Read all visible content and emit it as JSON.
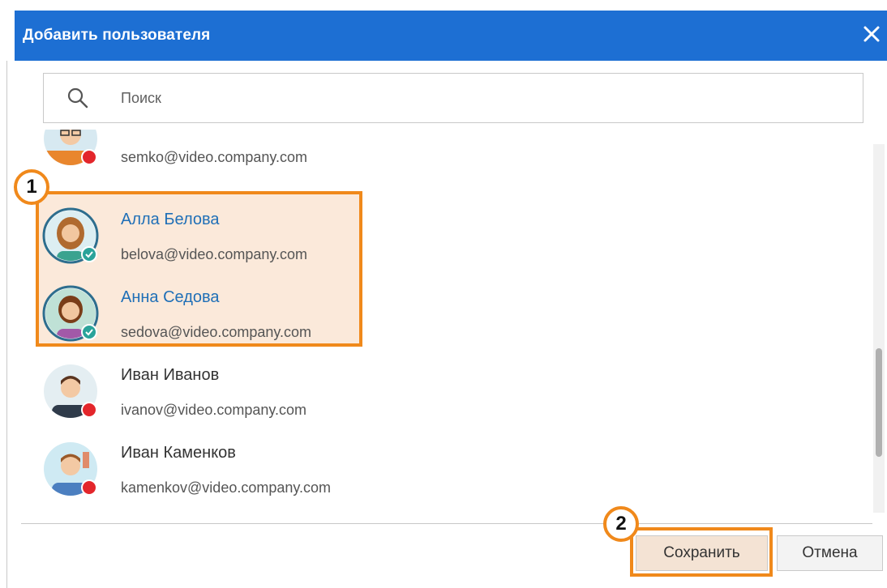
{
  "dialog": {
    "title": "Добавить пользователя"
  },
  "search": {
    "placeholder": "Поиск"
  },
  "users": [
    {
      "name": "",
      "email": "semko@video.company.com",
      "selected": false,
      "status": "offline"
    },
    {
      "name": "Алла Белова",
      "email": "belova@video.company.com",
      "selected": true,
      "status": "selected"
    },
    {
      "name": "Анна Седова",
      "email": "sedova@video.company.com",
      "selected": true,
      "status": "selected"
    },
    {
      "name": "Иван Иванов",
      "email": "ivanov@video.company.com",
      "selected": false,
      "status": "offline"
    },
    {
      "name": "Иван Каменков",
      "email": "kamenkov@video.company.com",
      "selected": false,
      "status": "offline"
    }
  ],
  "buttons": {
    "save_label": "Сохранить",
    "cancel_label": "Отмена"
  },
  "annotations": {
    "marker_1": "1",
    "marker_2": "2"
  },
  "colors": {
    "title_bar": "#1d6fd3",
    "highlight": "#f0891b",
    "selection_bg": "#fbe9da",
    "selected_name": "#1f6fb7",
    "status_offline": "#e3262b",
    "status_selected": "#2aa39a"
  }
}
